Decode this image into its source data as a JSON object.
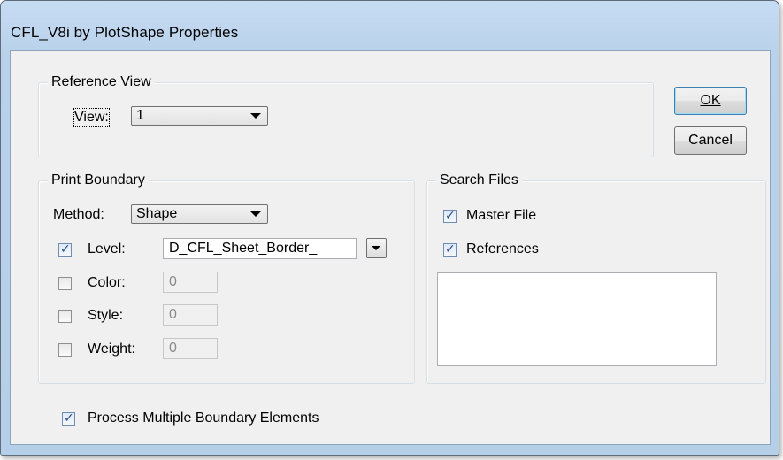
{
  "window": {
    "title": "CFL_V8i by PlotShape Properties"
  },
  "reference_view": {
    "group_label": "Reference View",
    "view_label": "View:",
    "view_value": "1"
  },
  "buttons": {
    "ok": "OK",
    "cancel": "Cancel"
  },
  "print_boundary": {
    "group_label": "Print Boundary",
    "method_label": "Method:",
    "method_value": "Shape",
    "level": {
      "label": "Level:",
      "checked": true,
      "value": "D_CFL_Sheet_Border_"
    },
    "color": {
      "label": "Color:",
      "checked": false,
      "value": "0"
    },
    "style": {
      "label": "Style:",
      "checked": false,
      "value": "0"
    },
    "weight": {
      "label": "Weight:",
      "checked": false,
      "value": "0"
    }
  },
  "search_files": {
    "group_label": "Search Files",
    "master_file": {
      "label": "Master File",
      "checked": true
    },
    "references": {
      "label": "References",
      "checked": true
    }
  },
  "process_multiple": {
    "label": "Process Multiple Boundary Elements",
    "checked": true
  },
  "check_glyph": "✓"
}
